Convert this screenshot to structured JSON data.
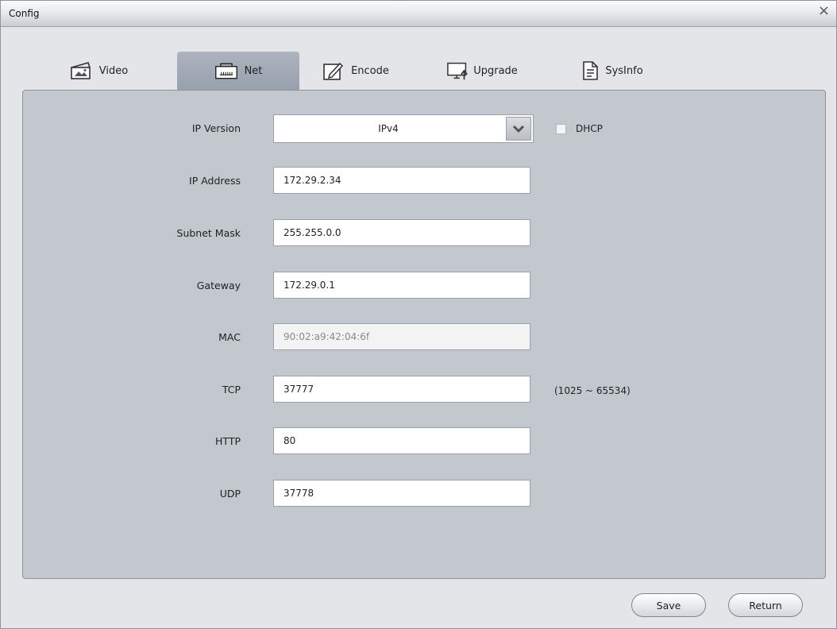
{
  "window": {
    "title": "Config",
    "close_glyph": "×"
  },
  "tabs": [
    {
      "label": "Video",
      "icon": "image-icon"
    },
    {
      "label": "Net",
      "icon": "network-port-icon",
      "active": true
    },
    {
      "label": "Encode",
      "icon": "edit-icon"
    },
    {
      "label": "Upgrade",
      "icon": "monitor-upgrade-icon"
    },
    {
      "label": "SysInfo",
      "icon": "document-icon"
    }
  ],
  "form": {
    "ip_version": {
      "label": "IP Version",
      "value": "IPv4"
    },
    "dhcp": {
      "label": "DHCP",
      "checked": false
    },
    "ip_address": {
      "label": "IP Address",
      "value": "172.29.2.34"
    },
    "subnet_mask": {
      "label": "Subnet Mask",
      "value": "255.255.0.0"
    },
    "gateway": {
      "label": "Gateway",
      "value": "172.29.0.1"
    },
    "mac": {
      "label": "MAC",
      "value": "90:02:a9:42:04:6f"
    },
    "tcp": {
      "label": "TCP",
      "value": "37777",
      "hint": "(1025 ~ 65534)"
    },
    "http": {
      "label": "HTTP",
      "value": "80"
    },
    "udp": {
      "label": "UDP",
      "value": "37778"
    }
  },
  "buttons": {
    "save": "Save",
    "return": "Return"
  },
  "colors": {
    "active_tab": "#9ea6b2",
    "panel": "#c3c7ce",
    "background": "#e4e5e8"
  }
}
